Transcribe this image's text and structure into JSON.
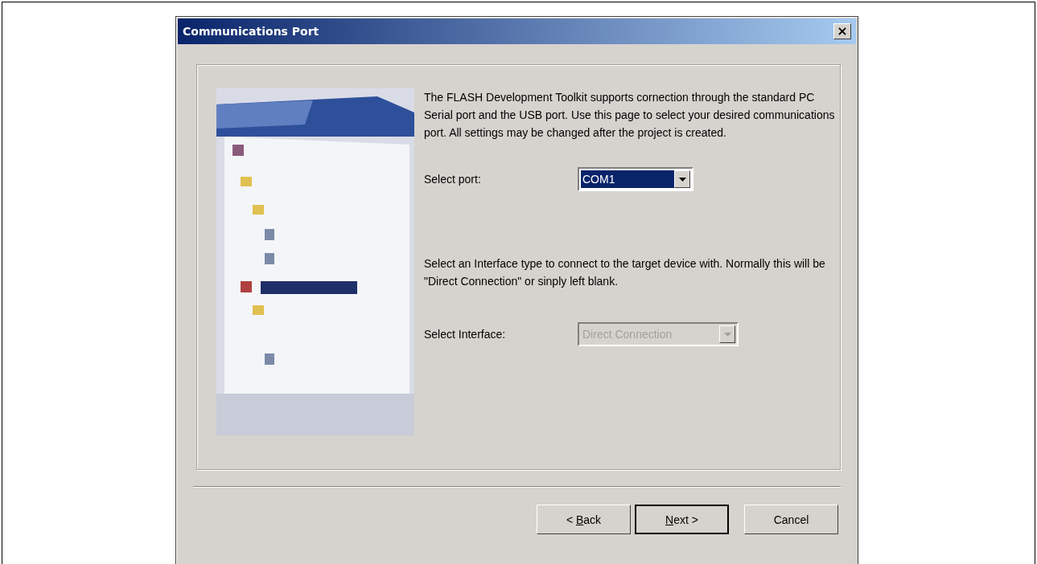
{
  "window": {
    "title": "Communications Port",
    "close": "×"
  },
  "description": "The FLASH Development Toolkit supports cornection through the standard PC Serial port and the USB port. Use this page to select your desired communications port. All settings may be changed after the project is created.",
  "port": {
    "label": "Select port:",
    "value": "COM1",
    "disabled": false
  },
  "interface_description": "Select an Interface type to connect to the target device with. Normally this will be \"Direct Connection\" or sinply left blank.",
  "interface": {
    "label": "Select Interface:",
    "value": "Direct Connection",
    "disabled": true
  },
  "buttons": [
    {
      "label": [
        {
          "text": "< ",
          "underline": false
        },
        {
          "text": "B",
          "underline": true
        },
        {
          "text": "ack",
          "underline": false
        }
      ],
      "default": false
    },
    {
      "label": [
        {
          "text": "N",
          "underline": true
        },
        {
          "text": "ext >",
          "underline": false
        }
      ],
      "default": true
    },
    {
      "label": [
        {
          "text": "Cancel",
          "underline": false
        }
      ],
      "default": false
    }
  ]
}
